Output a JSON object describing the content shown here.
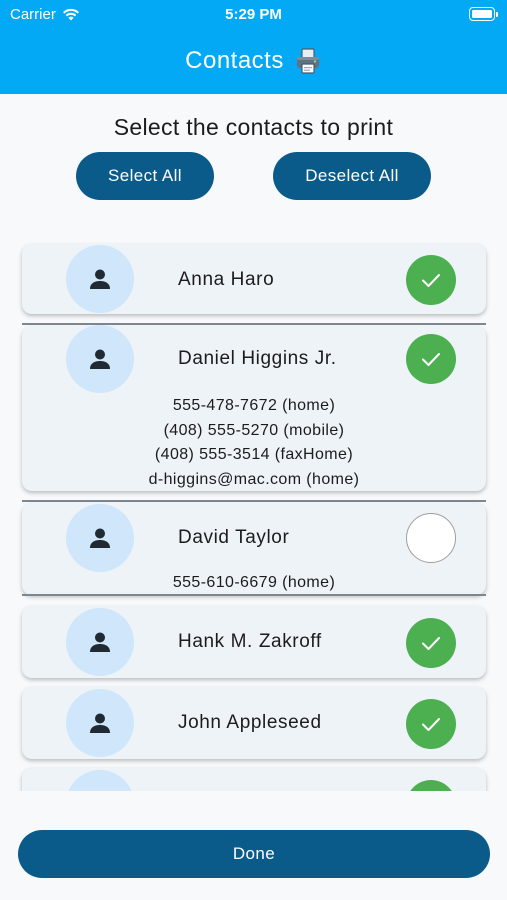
{
  "status_bar": {
    "carrier": "Carrier",
    "time": "5:29 PM"
  },
  "header": {
    "title": "Contacts",
    "icon": "printer-icon"
  },
  "instructions": "Select the contacts to print",
  "buttons": {
    "select_all": "Select All",
    "deselect_all": "Deselect All",
    "done": "Done"
  },
  "colors": {
    "header": "#03a9f4",
    "button": "#0a5b8a",
    "selected": "#4caf50",
    "avatar": "#cfe6fb",
    "card": "#eef3f8"
  },
  "contacts": [
    {
      "name": "Anna Haro",
      "selected": true,
      "details": []
    },
    {
      "name": "Daniel Higgins Jr.",
      "selected": true,
      "details": [
        "555-478-7672 (home)",
        "(408) 555-5270 (mobile)",
        "(408) 555-3514 (faxHome)",
        "d-higgins@mac.com (home)"
      ]
    },
    {
      "name": "David Taylor",
      "selected": false,
      "details": [
        "555-610-6679 (home)"
      ]
    },
    {
      "name": "Hank M. Zakroff",
      "selected": true,
      "details": []
    },
    {
      "name": "John Appleseed",
      "selected": true,
      "details": []
    },
    {
      "name": "",
      "selected": true,
      "details": []
    }
  ]
}
